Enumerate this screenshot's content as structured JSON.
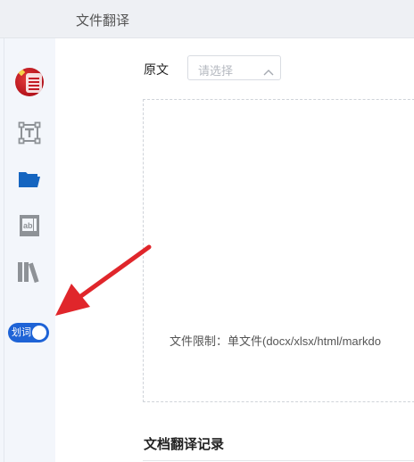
{
  "header": {
    "title": "文件翻译"
  },
  "sidebar": {
    "items": [
      {
        "name": "avatar"
      },
      {
        "name": "text-translate-icon"
      },
      {
        "name": "folder-icon"
      },
      {
        "name": "document-icon"
      },
      {
        "name": "library-icon"
      }
    ],
    "toggle": {
      "label": "划词",
      "state": "on"
    }
  },
  "source": {
    "label": "原文",
    "select_placeholder": "请选择"
  },
  "dropzone": {
    "limit_text": "文件限制：单文件(docx/xlsx/html/markdo"
  },
  "history": {
    "title": "文档翻译记录"
  },
  "colors": {
    "accent": "#1e63d6",
    "folder": "#1565c0",
    "arrow": "#e0262b",
    "icon_gray": "#8e9297"
  }
}
